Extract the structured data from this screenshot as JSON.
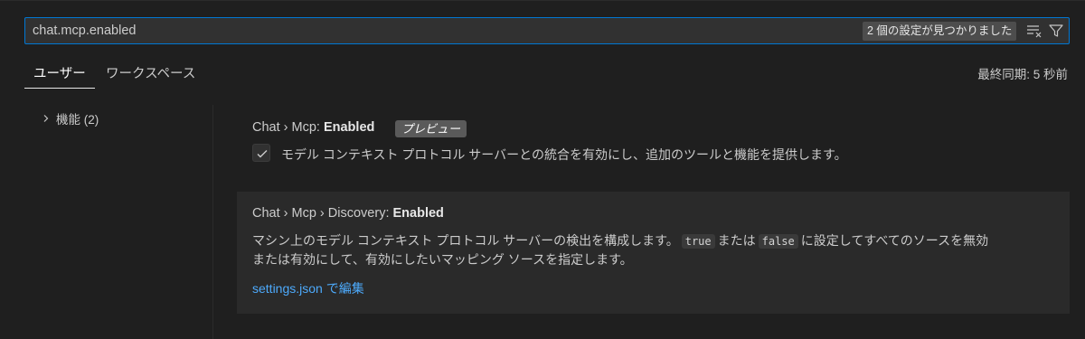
{
  "search": {
    "value": "chat.mcp.enabled",
    "result_count": "2 個の設定が見つかりました"
  },
  "tabs": [
    {
      "label": "ユーザー",
      "active": true
    },
    {
      "label": "ワークスペース",
      "active": false
    }
  ],
  "last_sync": "最終同期: 5 秒前",
  "tree": {
    "items": [
      {
        "label": "機能 (2)",
        "expanded": false
      }
    ]
  },
  "settings": [
    {
      "prefix": "Chat › Mcp: ",
      "name": "Enabled",
      "badge": "プレビュー",
      "checked": true,
      "description": "モデル コンテキスト プロトコル サーバーとの統合を有効にし、追加のツールと機能を提供します。"
    },
    {
      "prefix": "Chat › Mcp › Discovery: ",
      "name": "Enabled",
      "desc_part1": "マシン上のモデル コンテキスト プロトコル サーバーの検出を構成します。",
      "code_true": "true",
      "desc_part2": "または",
      "code_false": "false",
      "desc_part3": "に設定してすべてのソースを無効",
      "desc_line2": "または有効にして、有効にしたいマッピング ソースを指定します。",
      "edit_link": "settings.json で編集"
    }
  ],
  "colors": {
    "background": "#1f1f1f",
    "focus_border": "#0078d4",
    "link": "#4daafc",
    "focused_row": "#2a2a2a"
  },
  "icons": {
    "clear_filter": "clear-filter-icon",
    "filter": "filter-icon",
    "chevron": "chevron-right-icon",
    "check": "check-icon"
  }
}
